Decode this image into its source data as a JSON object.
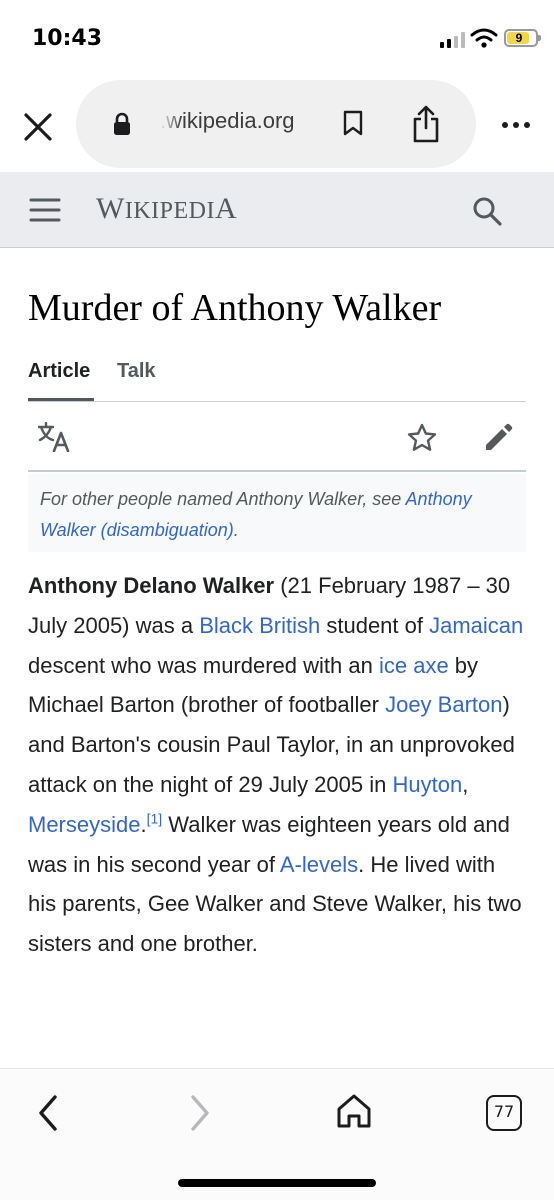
{
  "status_bar": {
    "time": "10:43",
    "battery": "9"
  },
  "browser": {
    "url": ".wikipedia.org"
  },
  "wiki_header": {
    "wordmark_initial": "W",
    "wordmark_rest": "IKIPEDI",
    "wordmark_final": "A"
  },
  "page": {
    "title": "Murder of Anthony Walker",
    "tabs": [
      {
        "label": "Article",
        "active": true
      },
      {
        "label": "Talk",
        "active": false
      }
    ]
  },
  "hatnote": {
    "text": "For other people named Anthony Walker, see ",
    "link": "Anthony Walker (disambiguation)",
    "end": "."
  },
  "paragraph": {
    "subject": "Anthony Delano Walker",
    "t1": " (21 February 1987 – 30 July 2005) was a ",
    "l1": "Black British",
    "t2": " student of ",
    "l2": "Jamaican",
    "t3": " descent who was murdered with an ",
    "l3": "ice axe",
    "t4": " by Michael Barton (brother of footballer ",
    "l4": "Joey Barton",
    "t5": ") and Barton's cousin Paul Taylor, in an unprovoked attack on the night of 29 July 2005 in ",
    "l5": "Huyton",
    "t6": ", ",
    "l6": "Merseyside",
    "t7": ".",
    "ref": "[1]",
    "t8": " Walker was eighteen years old and was in his second year of ",
    "l7": "A-levels",
    "t9": ". He lived with his parents, Gee Walker and Steve Walker, his two sisters and one brother."
  },
  "bottom_bar": {
    "tab_count": "77"
  },
  "colors": {
    "link": "#3366cc",
    "header_bg": "#eaecf0",
    "text": "#202122",
    "battery": "#f3d54a"
  }
}
